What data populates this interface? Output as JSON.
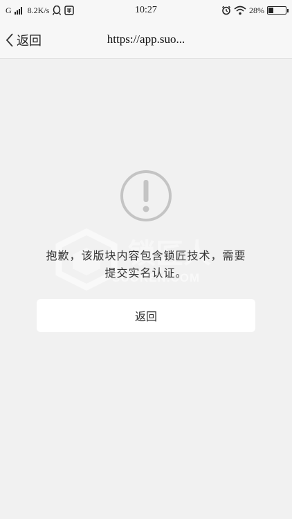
{
  "status_bar": {
    "carrier": "G",
    "network_speed": "8.2K/s",
    "time": "10:27",
    "battery_percent": "28%",
    "battery_level": 0.28,
    "icons": [
      "signal-icon",
      "qq-icon",
      "notification-icon",
      "alarm-icon",
      "wifi-icon",
      "battery-icon"
    ]
  },
  "nav": {
    "back_label": "返回",
    "url": "https://app.suo..."
  },
  "content": {
    "message": "抱歉，该版块内容包含锁匠技术，需要提交实名认证。",
    "button_label": "返回",
    "watermark_text": "SUOREN.COM"
  },
  "colors": {
    "background": "#f1f1f1",
    "bar_background": "#f7f7f7",
    "icon_gray": "#c4c4c4",
    "button_background": "#ffffff"
  }
}
